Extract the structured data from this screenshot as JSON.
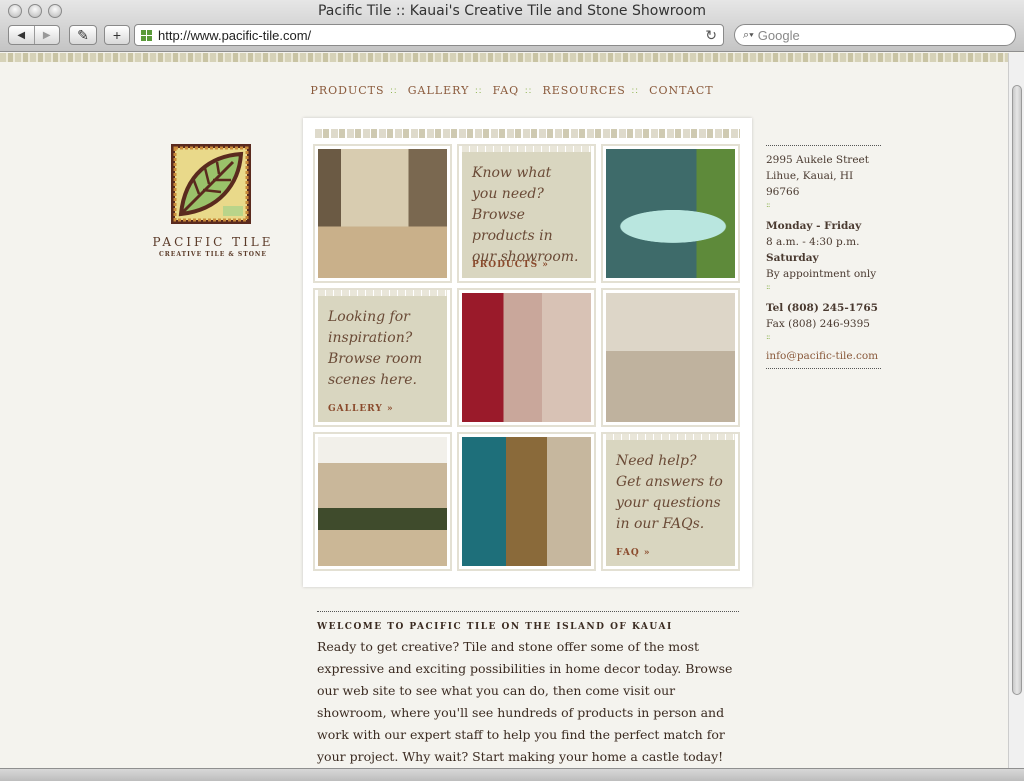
{
  "window": {
    "title": "Pacific Tile :: Kauai's Creative Tile and Stone Showroom"
  },
  "toolbar": {
    "url": "http://www.pacific-tile.com/",
    "search_placeholder": "Google"
  },
  "nav": {
    "items": [
      {
        "label": "PRODUCTS"
      },
      {
        "label": "GALLERY"
      },
      {
        "label": "FAQ"
      },
      {
        "label": "RESOURCES"
      },
      {
        "label": "CONTACT"
      }
    ]
  },
  "logo": {
    "name": "PACIFIC TILE",
    "tagline": "CREATIVE TILE & STONE"
  },
  "tiles": {
    "products": {
      "text": "Know what you need? Browse products in our showroom.",
      "link": "PRODUCTS »"
    },
    "gallery": {
      "text": "Looking for inspiration? Browse room scenes here.",
      "link": "GALLERY »"
    },
    "faq": {
      "text": "Need help? Get answers to your questions in our FAQs.",
      "link": "FAQ »"
    }
  },
  "contact": {
    "street": "2995 Aukele Street",
    "city": "Lihue, Kauai, HI 96766",
    "weekday_label": "Monday - Friday",
    "weekday_hours": "8 a.m. - 4:30 p.m.",
    "saturday_label": "Saturday",
    "saturday_hours": "By appointment only",
    "tel": "Tel (808) 245-1765",
    "fax": "Fax (808) 246-9395",
    "email": "info@pacific-tile.com"
  },
  "welcome": {
    "heading": "WELCOME TO PACIFIC TILE ON THE ISLAND OF KAUAI",
    "body": "Ready to get creative? Tile and stone offer some of the most expressive and exciting possibilities in home decor today. Browse our web site to see what you can do, then come visit our showroom, where you'll see hundreds of products in person and work with our expert staff to help you find the perfect match for your project. Why wait? Start making your home a castle today!"
  }
}
